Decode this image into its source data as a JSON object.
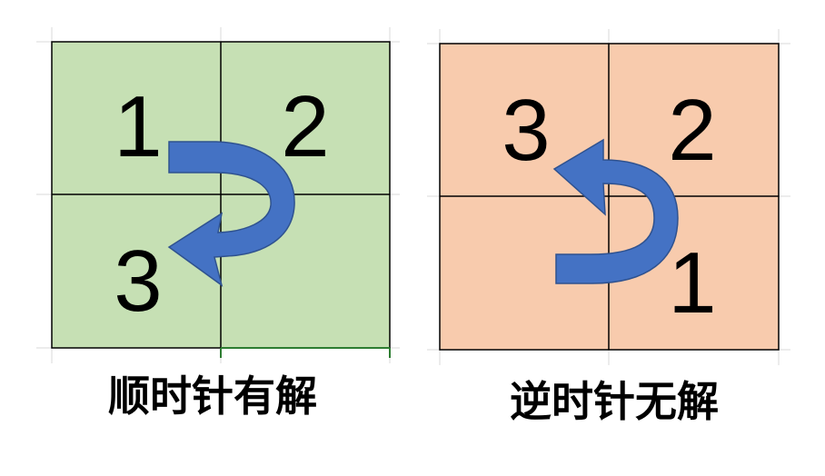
{
  "left_panel": {
    "fill_color": "#c6e0b4",
    "numbers": {
      "n1": "1",
      "n2": "2",
      "n3": "3"
    },
    "caption": "顺时针有解",
    "arrow_color": "#4472c4"
  },
  "right_panel": {
    "fill_color": "#f8cbad",
    "numbers": {
      "n3": "3",
      "n2": "2",
      "n1": "1"
    },
    "caption": "逆时针无解",
    "arrow_color": "#4472c4"
  }
}
